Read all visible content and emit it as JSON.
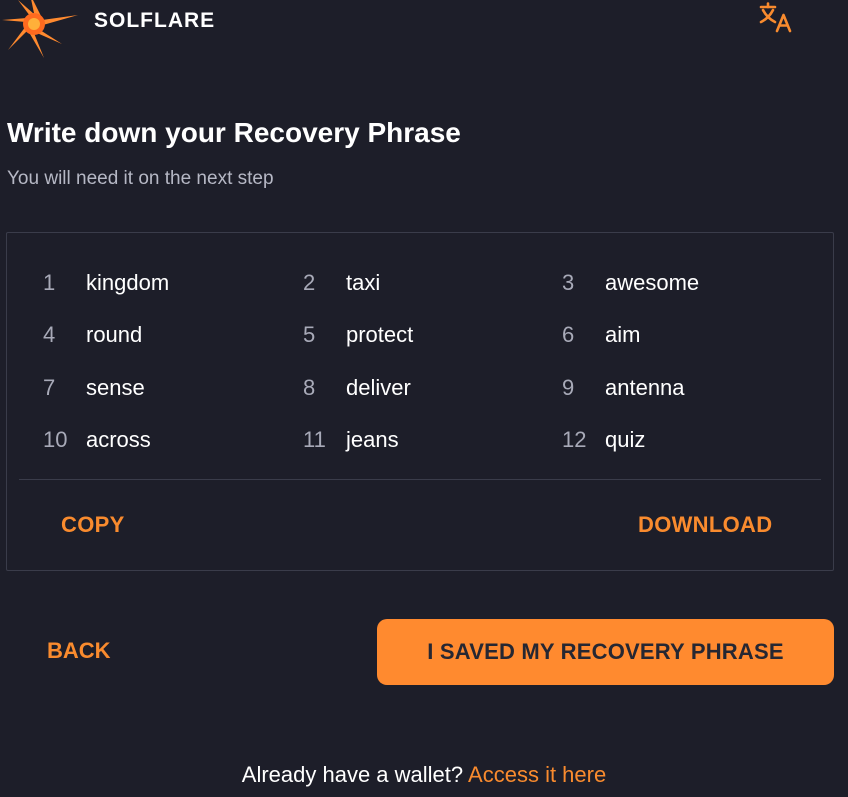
{
  "header": {
    "brand": "SOLFLARE",
    "icons": {
      "logo": "sun-logo-icon",
      "language": "translate-icon"
    }
  },
  "main": {
    "title": "Write down your Recovery Phrase",
    "subtitle": "You will need it on the next step"
  },
  "phrase": {
    "words": [
      {
        "num": "1",
        "word": "kingdom"
      },
      {
        "num": "2",
        "word": "taxi"
      },
      {
        "num": "3",
        "word": "awesome"
      },
      {
        "num": "4",
        "word": "round"
      },
      {
        "num": "5",
        "word": "protect"
      },
      {
        "num": "6",
        "word": "aim"
      },
      {
        "num": "7",
        "word": "sense"
      },
      {
        "num": "8",
        "word": "deliver"
      },
      {
        "num": "9",
        "word": "antenna"
      },
      {
        "num": "10",
        "word": "across"
      },
      {
        "num": "11",
        "word": "jeans"
      },
      {
        "num": "12",
        "word": "quiz"
      }
    ],
    "copy_label": "COPY",
    "download_label": "DOWNLOAD"
  },
  "actions": {
    "back_label": "BACK",
    "saved_label": "I SAVED MY RECOVERY PHRASE"
  },
  "footer": {
    "prompt": "Already have a wallet?",
    "link": "Access it here"
  },
  "colors": {
    "background": "#1d1e29",
    "accent": "#ff8a2f",
    "muted_text": "#b6b8c5",
    "border": "#3a3c4a"
  }
}
